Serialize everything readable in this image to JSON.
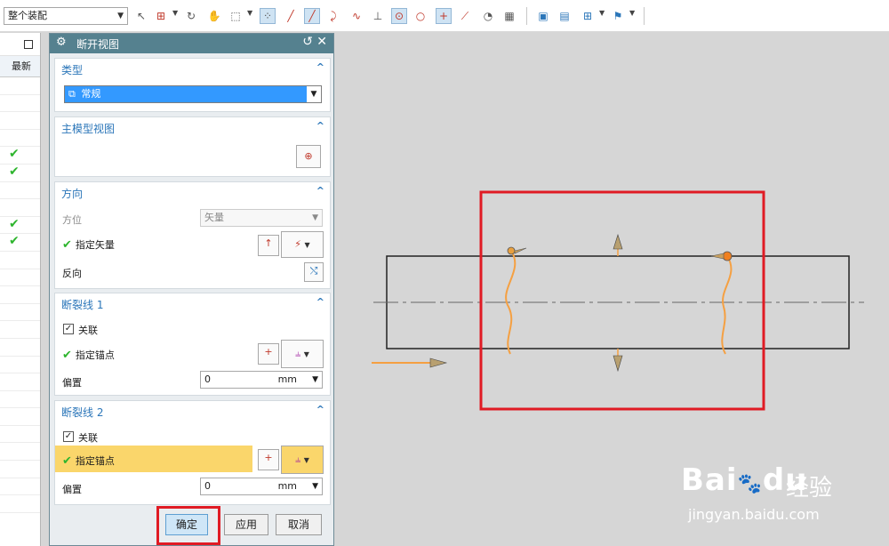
{
  "toolbar": {
    "assembly_filter": "整个装配",
    "icons": [
      "select-icon",
      "snap-icon",
      "rotate-icon",
      "hand-icon",
      "box-select-icon",
      "snap-point-icon",
      "line-icon",
      "pencil-icon",
      "curve-icon",
      "spline-icon",
      "perpendicular-icon",
      "circle-center-icon",
      "circle-icon",
      "plus-icon",
      "slash-icon",
      "paint-icon",
      "grid-icon",
      "view-icon",
      "window-icon",
      "table-icon",
      "flag-icon"
    ]
  },
  "left_panel": {
    "column_header": "最新",
    "check_rows": [
      5,
      6,
      9,
      10
    ]
  },
  "dialog": {
    "title": "断开视图",
    "type_section": {
      "title": "类型",
      "selected": "常规"
    },
    "main_view_section": {
      "title": "主模型视图"
    },
    "direction_section": {
      "title": "方向",
      "orientation_label": "方位",
      "orientation_value": "矢量",
      "vector_label": "指定矢量",
      "reverse_label": "反向"
    },
    "break_line_1": {
      "title": "断裂线 1",
      "associative_label": "关联",
      "associative_checked": true,
      "anchor_label": "指定锚点",
      "offset_label": "偏置",
      "offset_value": "0",
      "offset_unit": "mm"
    },
    "break_line_2": {
      "title": "断裂线 2",
      "associative_label": "关联",
      "associative_checked": true,
      "anchor_label": "指定锚点",
      "offset_label": "偏置",
      "offset_value": "0",
      "offset_unit": "mm"
    },
    "buttons": {
      "ok": "确定",
      "apply": "应用",
      "cancel": "取消"
    }
  },
  "watermark": {
    "brand": "Bai",
    "brand2": "du",
    "product": "经验",
    "url": "jingyan.baidu.com"
  },
  "colors": {
    "dialog_title": "#55818f",
    "section_title": "#2b76b9",
    "highlight": "#fad66b",
    "break_line": "#f5a042",
    "red_box": "#e01b24",
    "selection": "#3399ff"
  }
}
